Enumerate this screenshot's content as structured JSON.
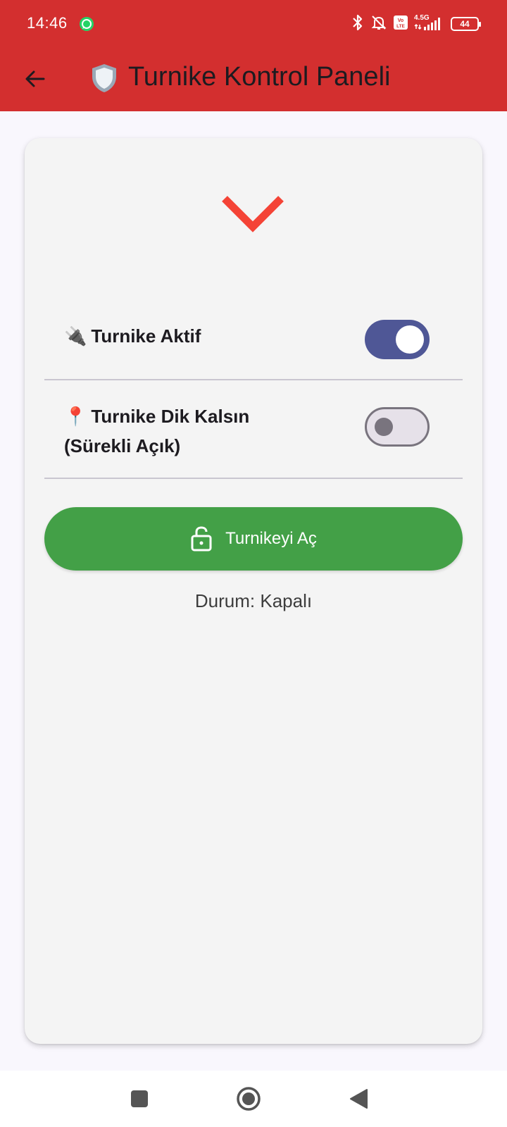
{
  "status_bar": {
    "time": "14:46",
    "network": "4.5G",
    "volte": "Vo LTE",
    "battery": "44",
    "icons": [
      "whatsapp-icon",
      "bluetooth-icon",
      "bell-off-icon",
      "volte-icon",
      "signal-icon",
      "battery-icon"
    ]
  },
  "app_bar": {
    "title_emoji": "🛡️",
    "title": "Turnike Kontrol Paneli",
    "back_icon": "arrow-left-icon",
    "background": "#d32f2f"
  },
  "card": {
    "header_icon": "chevron-down-icon",
    "header_icon_color": "#f44336",
    "toggles": [
      {
        "emoji": "🔌",
        "label": "Turnike Aktif",
        "on": true
      },
      {
        "emoji": "📍",
        "label": "Turnike Dik Kalsın (Sürekli Açık)",
        "on": false
      }
    ],
    "open_button": {
      "label": "Turnikeyi Aç",
      "icon": "lock-open-icon",
      "color": "#43a047"
    },
    "status_text": "Durum: Kapalı"
  },
  "nav_bar": {
    "buttons": [
      "recents-button",
      "home-button",
      "back-button"
    ]
  }
}
